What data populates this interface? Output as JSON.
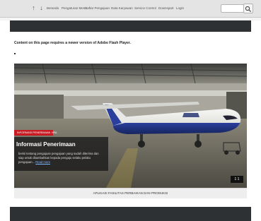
{
  "topbar": {
    "links": [
      "Beranda",
      "Pengaturan Menu",
      "Daftar Pengajuan",
      "Data Karyawan",
      "Service Control",
      "Downspart",
      "Login"
    ]
  },
  "flash": {
    "message": "Content on this page requires a newer version of Adobe Flash Player."
  },
  "slide": {
    "badge": "INFORMASI PENERIMAAN",
    "badge_sub": "HRA",
    "title": "Informasi Penerimaan",
    "description": "berisi tentang pengajuan pengajuan yang sudah diterima dan siap untuk ditambahkan kepada pengaju selaku pelaku pengajuan...",
    "read_more": "Read more",
    "pager": "1  1"
  },
  "caption": {
    "text": "APLIKASI FASILITAS PERBAIKAN DAN PRODUKSI"
  },
  "colors": {
    "dark_band": "#2d3134",
    "badge_red": "#c91b23"
  }
}
